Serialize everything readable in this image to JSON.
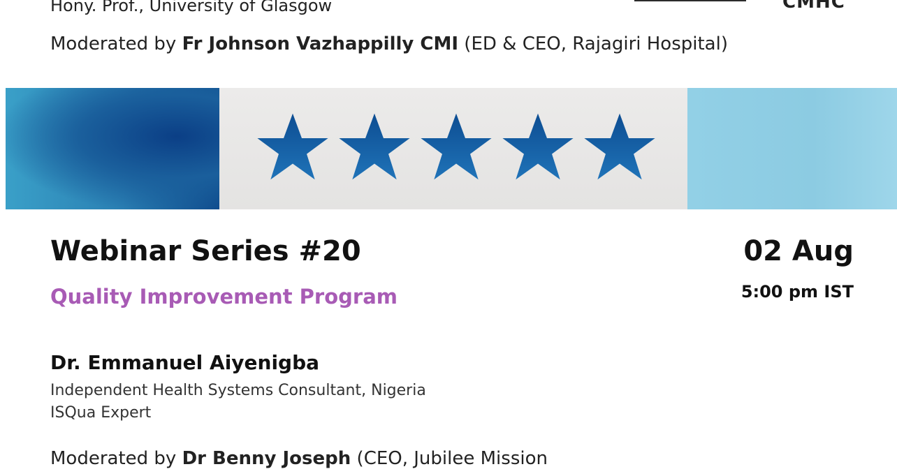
{
  "previous_event": {
    "speaker_affiliation": "Hony. Prof., University of Glasgow",
    "logo_text": "CMHC",
    "moderator": {
      "prefix": "Moderated by ",
      "name": "Fr Johnson Vazhappilly CMI",
      "suffix": " (ED & CEO, Rajagiri Hospital)"
    }
  },
  "banner": {
    "stars": 5,
    "star_color": "#0d4d92",
    "left_color": "#1a5f9c",
    "right_color": "#92d0e6"
  },
  "event": {
    "title": "Webinar Series #20",
    "subtitle": "Quality Improvement Program",
    "subtitle_color": "#a85bb5",
    "date": "02 Aug",
    "time": "5:00 pm IST",
    "speaker": {
      "name": "Dr. Emmanuel Aiyenigba",
      "roles": [
        "Independent Health Systems Consultant, Nigeria",
        "ISQua Expert"
      ]
    },
    "moderator": {
      "prefix": "Moderated by ",
      "name": "Dr  Benny Joseph",
      "suffix": " (CEO, Jubilee Mission"
    }
  }
}
